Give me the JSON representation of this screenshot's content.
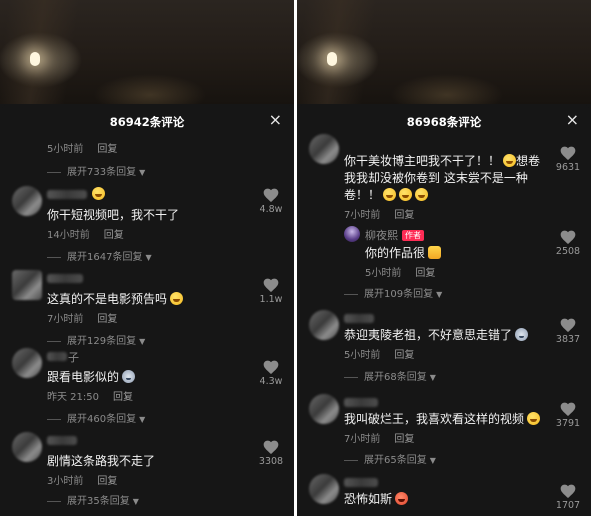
{
  "left": {
    "title": "86942条评论",
    "close_label": "×",
    "top_meta": {
      "time": "5小时前",
      "reply": "回复"
    },
    "top_expand": "展开733条回复",
    "comments": [
      {
        "text": "你干短视频吧，我不干了",
        "time": "14小时前",
        "reply": "回复",
        "likes": "4.8w",
        "expand": "展开1647条回复"
      },
      {
        "text": "这真的不是电影预告吗",
        "time": "7小时前",
        "reply": "回复",
        "likes": "1.1w",
        "expand": "展开129条回复"
      },
      {
        "name_suffix": "子",
        "text": "跟看电影似的",
        "time": "昨天 21:50",
        "reply": "回复",
        "likes": "4.3w",
        "expand": "展开460条回复"
      },
      {
        "text": "剧情这条路我不走了",
        "time": "3小时前",
        "reply": "回复",
        "likes": "3308",
        "expand": "展开35条回复"
      }
    ]
  },
  "right": {
    "title": "86968条评论",
    "close_label": "×",
    "comments": [
      {
        "text_line1": "你干美妆博主吧我不干了！！",
        "text_line1_tail": "想卷",
        "text_line2": "我我却没被你卷到 这末尝不是一种",
        "text_line3": "卷！！",
        "time": "7小时前",
        "reply": "回复",
        "likes": "9631"
      },
      {
        "name": "柳夜熙",
        "badge": "作者",
        "text": "你的作品很",
        "time": "5小时前",
        "reply": "回复",
        "likes": "2508",
        "expand": "展开109条回复"
      },
      {
        "text": "恭迎夷陵老祖，不好意思走错了",
        "time": "5小时前",
        "reply": "回复",
        "likes": "3837",
        "expand": "展开68条回复"
      },
      {
        "text": "我叫破烂王，我喜欢看这样的视频",
        "time": "7小时前",
        "reply": "回复",
        "likes": "3791",
        "expand": "展开65条回复"
      },
      {
        "text": "恐怖如斯",
        "likes": "1707"
      }
    ]
  },
  "icons": {
    "heart": "heart-icon",
    "close": "close-icon",
    "chevron": "chevron-down-icon"
  },
  "colors": {
    "sheet_bg": "#161616",
    "badge": "#fe2c55"
  }
}
